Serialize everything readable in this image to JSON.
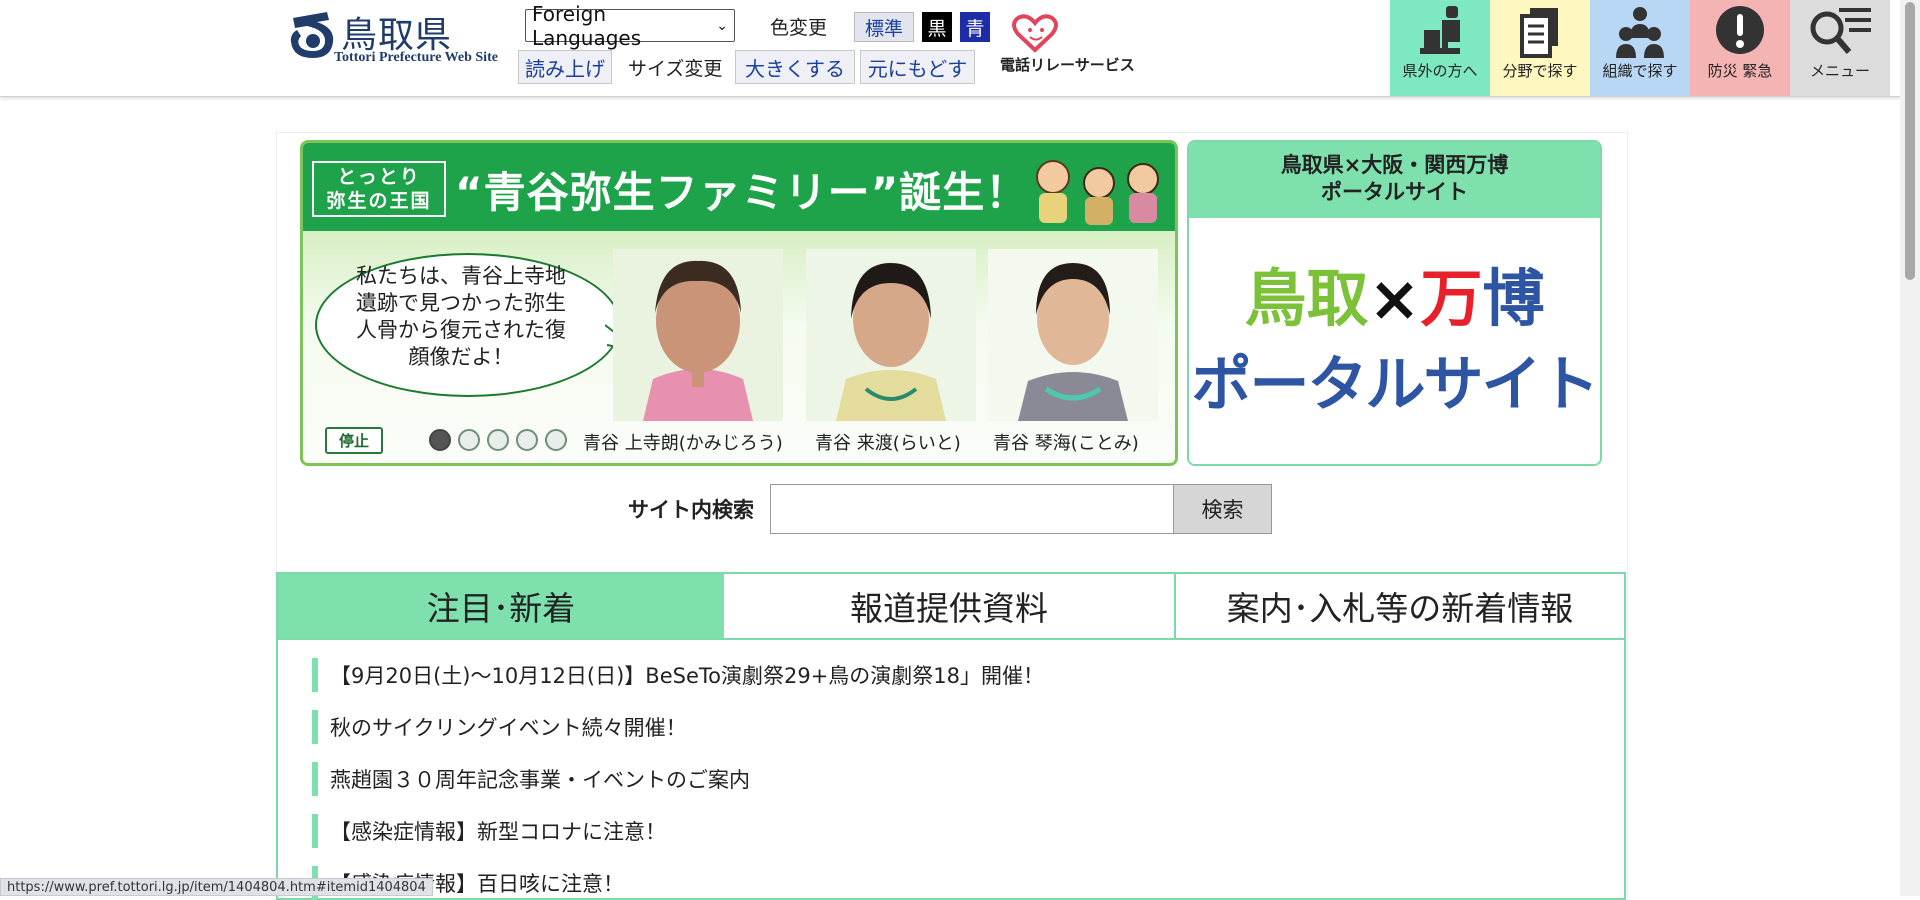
{
  "header": {
    "logo_title": "鳥取県",
    "logo_sub": "Tottori Prefecture Web Site",
    "language_select": "Foreign Languages",
    "color_change_label": "色変更",
    "color_standard": "標準",
    "color_black": "黒",
    "color_blue": "青",
    "read_aloud": "読み上げ",
    "size_change_label": "サイズ変更",
    "size_bigger": "大きくする",
    "size_reset": "元にもどす",
    "relay_service": "電話リレーサービス",
    "nav": [
      {
        "label": "県外の方へ",
        "color": "#7ee8c0",
        "icon": "chair-person-icon"
      },
      {
        "label": "分野で探す",
        "color": "#fff7c0",
        "icon": "documents-icon"
      },
      {
        "label": "組織で探す",
        "color": "#b7d7f4",
        "icon": "people-icon"
      },
      {
        "label": "防災 緊急",
        "color": "#f4b4b4",
        "icon": "exclamation-icon"
      },
      {
        "label": "メニュー",
        "color": "#dcdcdc",
        "icon": "search-menu-icon"
      }
    ]
  },
  "banner": {
    "badge": "とっとり\n弥生の王国",
    "title": "“青谷弥生ファミリー”誕生！",
    "bubble_text": "私たちは、青谷上寺地遺跡で見つかった弥生人骨から復元された復顔像だよ！",
    "stop_button": "停止",
    "captions": [
      "青谷 上寺朗(かみじろう)",
      "青谷 来渡(らいと)",
      "青谷 琴海(ことみ)"
    ],
    "dots_total": 5,
    "dots_active": 1
  },
  "expo": {
    "header": "鳥取県×大阪・関西万博\nポータルサイト",
    "line1_a": "鳥取",
    "line1_b": "×",
    "line1_c": "万博",
    "line2": "ポータルサイト"
  },
  "search": {
    "label": "サイト内検索",
    "placeholder": "",
    "button": "検索"
  },
  "tabs": [
    {
      "label": "注目･新着",
      "active": true
    },
    {
      "label": "報道提供資料",
      "active": false
    },
    {
      "label": "案内･入札等の新着情報",
      "active": false
    }
  ],
  "news": [
    "【9月20日(土)～10月12日(日)】BeSeTo演劇祭29+鳥の演劇祭18」開催！",
    "秋のサイクリングイベント続々開催！",
    "燕趙園３０周年記念事業・イベントのご案内",
    "【感染症情報】新型コロナに注意！",
    "【感染症情報】百日咳に注意！"
  ],
  "status_url": "https://www.pref.tottori.lg.jp/item/1404804.htm#itemid1404804"
}
